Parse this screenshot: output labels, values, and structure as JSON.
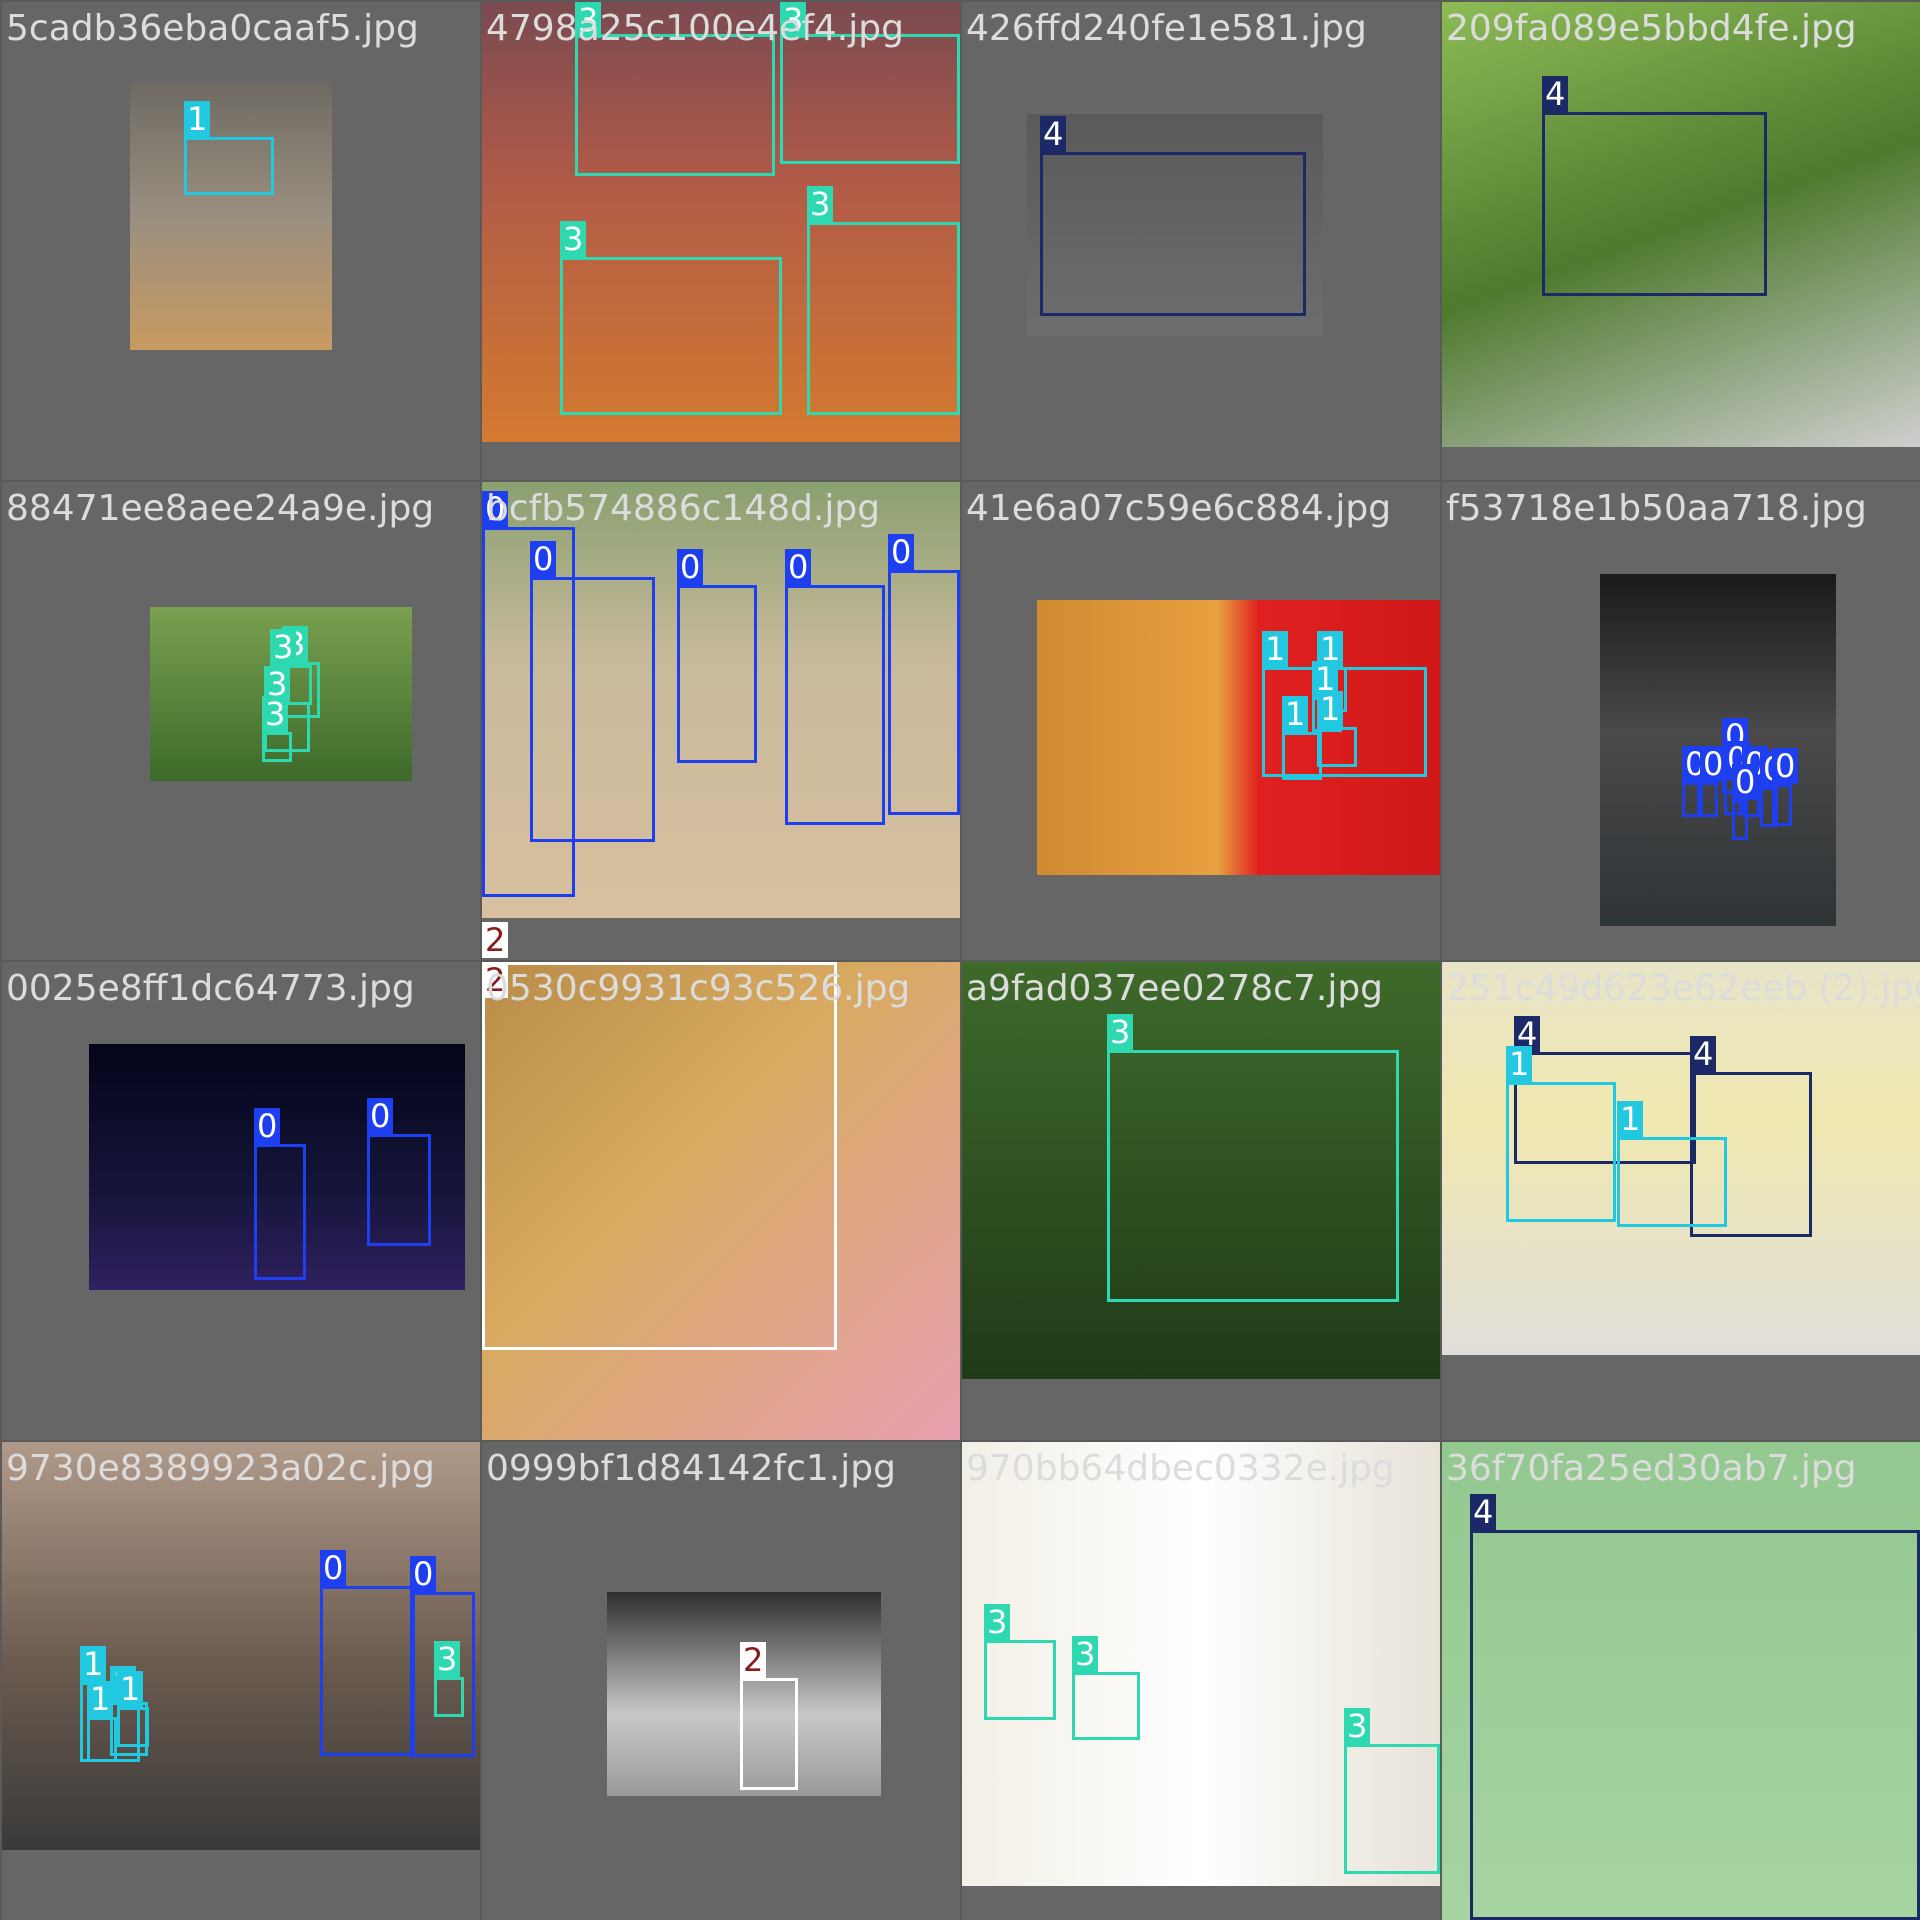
{
  "colors": {
    "class_0": "#1e3ff0",
    "class_1": "#22c8e0",
    "class_2": "#ffffff",
    "class_3": "#2ed8b0",
    "class_4": "#1b2a66"
  },
  "tiles": [
    {
      "filename": "5cadb36eba0caaf5.jpg",
      "img_bg": "linear-gradient(#6e6a62,#9a8f80 50%,#c89a60)",
      "img": [
        128,
        80,
        202,
        268
      ],
      "labels": [
        {
          "cls": "1",
          "b": [
            182,
            135,
            90,
            58
          ]
        }
      ]
    },
    {
      "filename": "4798a25c100e4ef4.jpg",
      "img_bg": "linear-gradient(#7a4a50,#b05a48 40%,#d47a30)",
      "img": [
        0,
        0,
        478,
        440
      ],
      "labels": [
        {
          "cls": "3",
          "b": [
            93,
            32,
            200,
            142
          ]
        },
        {
          "cls": "3",
          "b": [
            298,
            32,
            180,
            130
          ]
        },
        {
          "cls": "3",
          "b": [
            78,
            255,
            222,
            158
          ]
        },
        {
          "cls": "3",
          "b": [
            325,
            220,
            153,
            193
          ]
        }
      ]
    },
    {
      "filename": "426ffd240fe1e581.jpg",
      "img_bg": "linear-gradient(#5a5a5a,#6d6d6d)",
      "img": [
        65,
        112,
        296,
        222
      ],
      "labels": [
        {
          "cls": "4",
          "b": [
            78,
            150,
            266,
            164
          ]
        }
      ]
    },
    {
      "filename": "209fa089e5bbd4fe.jpg",
      "img_bg": "linear-gradient(160deg,#8dbb55,#4e7a2e 50%,#cfcfcf)",
      "img": [
        0,
        0,
        478,
        445
      ],
      "labels": [
        {
          "cls": "4",
          "b": [
            100,
            110,
            225,
            184
          ]
        }
      ]
    },
    {
      "filename": "88471ee8aee24a9e.jpg",
      "img_bg": "linear-gradient(#7aa050,#3d6a2a)",
      "img": [
        148,
        125,
        262,
        174
      ],
      "labels": [
        {
          "cls": "3",
          "b": [
            280,
            180,
            38,
            56
          ]
        },
        {
          "cls": "3",
          "b": [
            268,
            183,
            42,
            40
          ]
        },
        {
          "cls": "3",
          "b": [
            262,
            220,
            46,
            50
          ]
        },
        {
          "cls": "3",
          "b": [
            260,
            250,
            30,
            30
          ]
        }
      ]
    },
    {
      "filename": "bcfb574886c148d.jpg",
      "img_bg": "linear-gradient(#8aa070,#c7b99a 40%,#d8c0a0)",
      "img": [
        0,
        0,
        478,
        436
      ],
      "labels": [
        {
          "cls": "0",
          "b": [
            0,
            45,
            93,
            370
          ]
        },
        {
          "cls": "0",
          "b": [
            48,
            95,
            125,
            265
          ]
        },
        {
          "cls": "0",
          "b": [
            195,
            103,
            80,
            178
          ]
        },
        {
          "cls": "0",
          "b": [
            303,
            103,
            100,
            240
          ]
        },
        {
          "cls": "0",
          "b": [
            406,
            88,
            72,
            245
          ]
        }
      ],
      "extra_tag": "2"
    },
    {
      "filename": "41e6a07c59e6c884.jpg",
      "img_bg": "linear-gradient(90deg,#d08a30,#e8a040 45%,#e02020 55%,#d01818)",
      "img": [
        75,
        118,
        403,
        275
      ],
      "labels": [
        {
          "cls": "1",
          "b": [
            300,
            185,
            165,
            110
          ]
        },
        {
          "cls": "1",
          "b": [
            355,
            185,
            30,
            45
          ]
        },
        {
          "cls": "1",
          "b": [
            350,
            215,
            30,
            35
          ]
        },
        {
          "cls": "1",
          "b": [
            320,
            250,
            40,
            48
          ]
        },
        {
          "cls": "1",
          "b": [
            355,
            245,
            40,
            40
          ]
        }
      ]
    },
    {
      "filename": "f53718e1b50aa718.jpg",
      "img_bg": "linear-gradient(#1a1a1a,#4a4a4a 45%,#2e3336)",
      "img": [
        158,
        92,
        236,
        352
      ],
      "labels": [
        {
          "cls": "0",
          "b": [
            280,
            272,
            22,
            40
          ]
        },
        {
          "cls": "0",
          "b": [
            240,
            300,
            18,
            35
          ]
        },
        {
          "cls": "0",
          "b": [
            258,
            300,
            18,
            35
          ]
        },
        {
          "cls": "0",
          "b": [
            282,
            295,
            18,
            38
          ]
        },
        {
          "cls": "0",
          "b": [
            300,
            300,
            18,
            35
          ]
        },
        {
          "cls": "0",
          "b": [
            318,
            305,
            18,
            40
          ]
        },
        {
          "cls": "0",
          "b": [
            330,
            302,
            20,
            42
          ]
        },
        {
          "cls": "0",
          "b": [
            290,
            318,
            16,
            40
          ]
        }
      ]
    },
    {
      "filename": "0025e8ff1dc64773.jpg",
      "img_bg": "linear-gradient(#04041a,#15153a 60%,#302060)",
      "img": [
        87,
        82,
        376,
        246
      ],
      "labels": [
        {
          "cls": "0",
          "b": [
            252,
            182,
            52,
            136
          ]
        },
        {
          "cls": "0",
          "b": [
            365,
            172,
            64,
            112
          ]
        }
      ]
    },
    {
      "filename": "0530c9931c93c526.jpg",
      "img_bg": "linear-gradient(135deg,#b88c48,#d8aa60 40%,#e8a0b0)",
      "img": [
        0,
        0,
        478,
        478
      ],
      "labels": [
        {
          "cls": "2",
          "b": [
            0,
            0,
            355,
            388
          ]
        }
      ]
    },
    {
      "filename": "a9fad037ee0278c7.jpg",
      "img_bg": "linear-gradient(#3e6a2a,#1f3a18)",
      "img": [
        0,
        0,
        478,
        417
      ],
      "labels": [
        {
          "cls": "3",
          "b": [
            145,
            88,
            292,
            252
          ]
        }
      ]
    },
    {
      "filename": "251c49d623e62eeb (2).jpg",
      "img_bg": "linear-gradient(#e8e4c8,#f0e8b0 40%,#e0ded8)",
      "img": [
        0,
        0,
        478,
        393
      ],
      "labels": [
        {
          "cls": "4",
          "b": [
            72,
            90,
            182,
            112
          ]
        },
        {
          "cls": "4",
          "b": [
            248,
            110,
            122,
            165
          ]
        },
        {
          "cls": "1",
          "b": [
            64,
            120,
            110,
            140
          ]
        },
        {
          "cls": "1",
          "b": [
            175,
            175,
            110,
            90
          ]
        }
      ]
    },
    {
      "filename": "9730e8389923a02c.jpg",
      "img_bg": "linear-gradient(#b09a8a,#6a5a4e 55%,#3a3a3a)",
      "img": [
        0,
        0,
        478,
        408
      ],
      "labels": [
        {
          "cls": "0",
          "b": [
            318,
            144,
            95,
            170
          ]
        },
        {
          "cls": "0",
          "b": [
            408,
            150,
            65,
            165
          ]
        },
        {
          "cls": "3",
          "b": [
            432,
            235,
            30,
            40
          ]
        },
        {
          "cls": "1",
          "b": [
            78,
            240,
            60,
            80
          ]
        },
        {
          "cls": "1",
          "b": [
            108,
            260,
            38,
            54
          ]
        },
        {
          "cls": "1",
          "b": [
            115,
            265,
            32,
            40
          ]
        },
        {
          "cls": "1",
          "b": [
            85,
            275,
            30,
            45
          ]
        }
      ]
    },
    {
      "filename": "0999bf1d84142fc1.jpg",
      "img_bg": "linear-gradient(#2e2e2e,#c8c8c8 60%,#9a9a9a)",
      "img": [
        125,
        150,
        274,
        204
      ],
      "labels": [
        {
          "cls": "2",
          "b": [
            258,
            236,
            58,
            112
          ]
        }
      ]
    },
    {
      "filename": "970bb64dbec0332e.jpg",
      "img_bg": "linear-gradient(90deg,#f2efe6,#ffffff 50%,#e7e2d8)",
      "img": [
        0,
        0,
        478,
        444
      ],
      "labels": [
        {
          "cls": "3",
          "b": [
            22,
            198,
            72,
            80
          ]
        },
        {
          "cls": "3",
          "b": [
            110,
            230,
            68,
            68
          ]
        },
        {
          "cls": "3",
          "b": [
            382,
            302,
            96,
            130
          ]
        }
      ]
    },
    {
      "filename": "36f70fa25ed30ab7.jpg",
      "img_bg": "linear-gradient(#93c890,#a6d4a0)",
      "img": [
        0,
        0,
        478,
        478
      ],
      "labels": [
        {
          "cls": "4",
          "b": [
            28,
            88,
            450,
            390
          ]
        }
      ]
    }
  ]
}
